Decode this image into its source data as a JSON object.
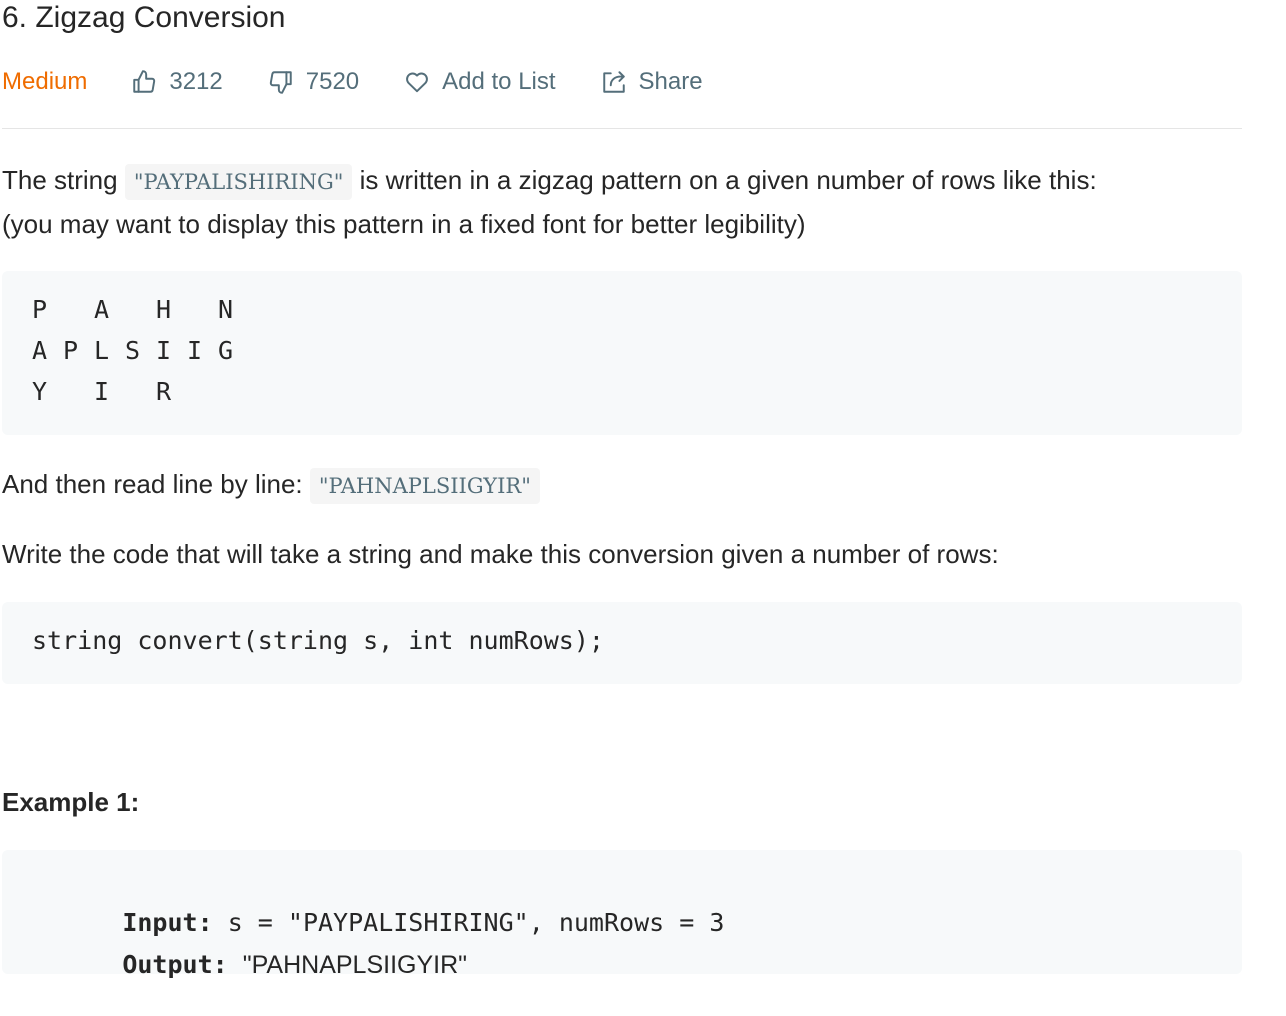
{
  "problem": {
    "title": "6. Zigzag Conversion",
    "difficulty": "Medium",
    "likes": "3212",
    "dislikes": "7520",
    "add_to_list_label": "Add to List",
    "share_label": "Share"
  },
  "description": {
    "p1_prefix": "The string",
    "p1_code": "\"PAYPALISHIRING\"",
    "p1_suffix": "is written in a zigzag pattern on a given number of rows like this:",
    "p1_line2": "(you may want to display this pattern in a fixed font for better legibility)",
    "zigzag_rows": [
      [
        "P",
        "",
        "A",
        "",
        "H",
        "",
        "N"
      ],
      [
        "A",
        "P",
        "L",
        "S",
        "I",
        "I",
        "G"
      ],
      [
        "Y",
        "",
        "I",
        "",
        "R",
        "",
        ""
      ]
    ],
    "p2_prefix": "And then read line by line:",
    "p2_code": "\"PAHNAPLSIIGYIR\"",
    "p3": "Write the code that will take a string and make this conversion given a number of rows:",
    "signature": "string convert(string s, int numRows);"
  },
  "example1": {
    "heading": "Example 1:",
    "input_label": "Input:",
    "input_value": "s = \"PAYPALISHIRING\", numRows = 3",
    "output_label": "Output:",
    "output_value": "\"PAHNAPLSIIGYIR\""
  },
  "colors": {
    "difficulty_medium": "#ef6c00",
    "meta_gray": "#546e7a",
    "code_bg": "#f7f9fa",
    "text": "#262626"
  },
  "icons": {
    "likes": "thumbs-up-icon",
    "dislikes": "thumbs-down-icon",
    "add_to_list": "heart-icon",
    "share": "share-icon"
  }
}
